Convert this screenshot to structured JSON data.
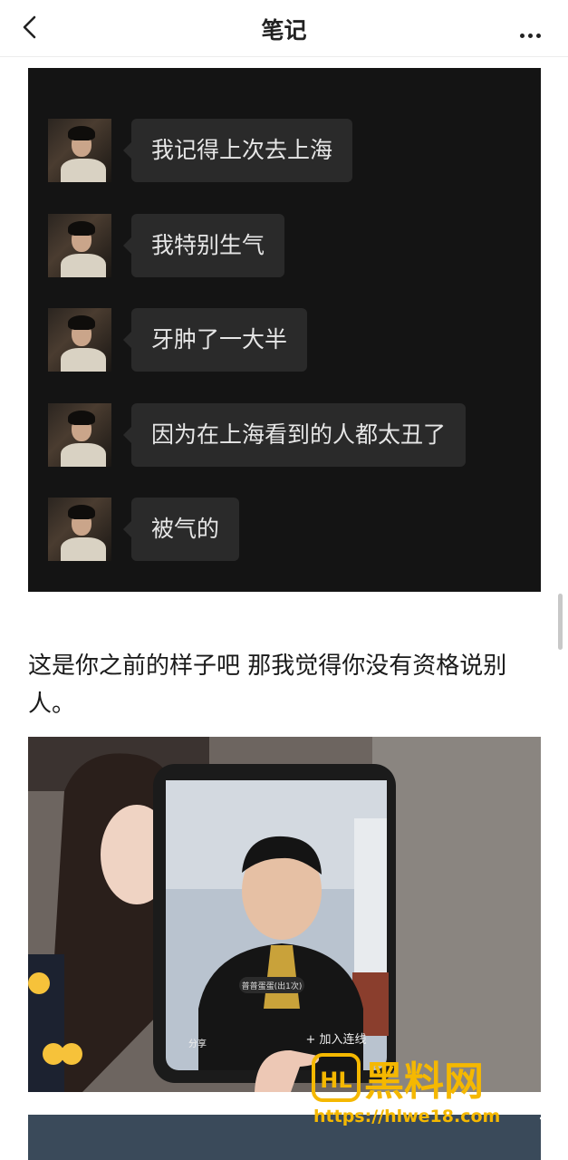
{
  "header": {
    "title": "笔记"
  },
  "chat": {
    "messages": [
      {
        "text": "我记得上次去上海"
      },
      {
        "text": "我特别生气"
      },
      {
        "text": "牙肿了一大半"
      },
      {
        "text": "因为在上海看到的人都太丑了"
      },
      {
        "text": "被气的"
      }
    ]
  },
  "post": {
    "caption": "这是你之前的样子吧 那我觉得你没有资格说别人。"
  },
  "photo": {
    "tablet_pill": "普普蛋蛋(出1次)",
    "tablet_share": "分享",
    "tablet_action": "+ 加入连线"
  },
  "watermark": {
    "brand": "黑料网",
    "url": "https://hlwe18.com"
  },
  "colors": {
    "chat_bg": "#141414",
    "bubble_bg": "#2a2a2a",
    "watermark": "#f5b800"
  }
}
